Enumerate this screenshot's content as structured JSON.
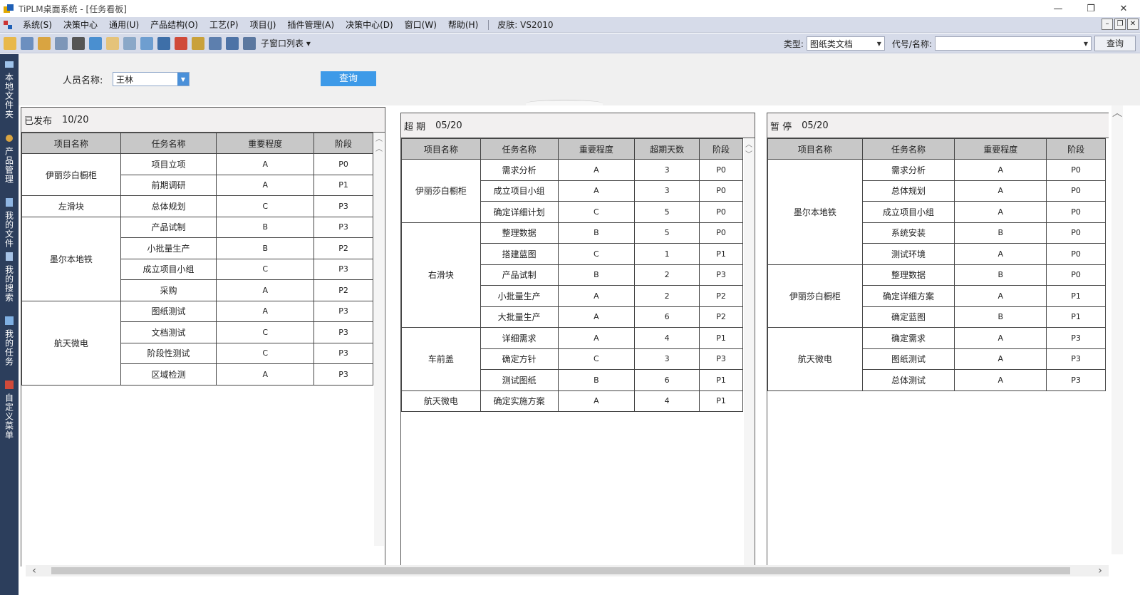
{
  "window": {
    "title": "TiPLM桌面系统 - [任务看板]",
    "minimize": "—",
    "restore": "❐",
    "close": "✕"
  },
  "menubar": {
    "items": [
      "系统(S)",
      "决策中心",
      "通用(U)",
      "产品结构(O)",
      "工艺(P)",
      "项目(J)",
      "插件管理(A)",
      "决策中心(D)",
      "窗口(W)",
      "帮助(H)"
    ],
    "skin": "皮肤:  VS2010",
    "mdi": [
      "–",
      "❐",
      "✕"
    ]
  },
  "toolbar": {
    "subwindow_list": "子窗口列表 ▾",
    "type_label": "类型:",
    "type_value": "图纸类文档",
    "code_label": "代号/名称:",
    "code_value": "",
    "query": "查询"
  },
  "sidebar": {
    "items": [
      "本地文件夹",
      "产品管理",
      "我的文件",
      "我的搜索",
      "我的任务",
      "自定义菜单"
    ]
  },
  "filter": {
    "person_label": "人员名称:",
    "person_value": "王林",
    "search": "查询"
  },
  "colors": {
    "sidebar_bg": "#2c3e5c",
    "menubar_bg": "#d6dbe9",
    "accent": "#3d9ae8",
    "header_bg": "#c8c8c8"
  },
  "panels": {
    "published": {
      "title": "已发布",
      "count": "10/20",
      "headers": [
        "项目名称",
        "任务名称",
        "重要程度",
        "阶段"
      ],
      "groups": [
        {
          "project": "伊丽莎白橱柜",
          "rows": [
            [
              "项目立项",
              "A",
              "P0"
            ],
            [
              "前期调研",
              "A",
              "P1"
            ]
          ]
        },
        {
          "project": "左滑块",
          "rows": [
            [
              "总体规划",
              "C",
              "P3"
            ]
          ]
        },
        {
          "project": "墨尔本地铁",
          "rows": [
            [
              "产品试制",
              "B",
              "P3"
            ],
            [
              "小批量生产",
              "B",
              "P2"
            ],
            [
              "成立项目小组",
              "C",
              "P3"
            ],
            [
              "采购",
              "A",
              "P2"
            ]
          ]
        },
        {
          "project": "航天微电",
          "rows": [
            [
              "图纸测试",
              "A",
              "P3"
            ],
            [
              "文档测试",
              "C",
              "P3"
            ],
            [
              "阶段性测试",
              "C",
              "P3"
            ],
            [
              "区域检测",
              "A",
              "P3"
            ]
          ]
        }
      ]
    },
    "overdue": {
      "title": "超  期",
      "count": "05/20",
      "headers": [
        "项目名称",
        "任务名称",
        "重要程度",
        "超期天数",
        "阶段"
      ],
      "groups": [
        {
          "project": "伊丽莎白橱柜",
          "rows": [
            [
              "需求分析",
              "A",
              "3",
              "P0"
            ],
            [
              "成立项目小组",
              "A",
              "3",
              "P0"
            ],
            [
              "确定详细计划",
              "C",
              "5",
              "P0"
            ]
          ]
        },
        {
          "project": "右滑块",
          "rows": [
            [
              "整理数据",
              "B",
              "5",
              "P0"
            ],
            [
              "搭建蓝图",
              "C",
              "1",
              "P1"
            ],
            [
              "产品试制",
              "B",
              "2",
              "P3"
            ],
            [
              "小批量生产",
              "A",
              "2",
              "P2"
            ],
            [
              "大批量生产",
              "A",
              "6",
              "P2"
            ]
          ]
        },
        {
          "project": "车前盖",
          "rows": [
            [
              "详细需求",
              "A",
              "4",
              "P1"
            ],
            [
              "确定方针",
              "C",
              "3",
              "P3"
            ],
            [
              "测试图纸",
              "B",
              "6",
              "P1"
            ]
          ]
        },
        {
          "project": "航天微电",
          "rows": [
            [
              "确定实施方案",
              "A",
              "4",
              "P1"
            ]
          ]
        }
      ]
    },
    "paused": {
      "title": "暂  停",
      "count": "05/20",
      "headers": [
        "项目名称",
        "任务名称",
        "重要程度",
        "阶段"
      ],
      "groups": [
        {
          "project": "墨尔本地铁",
          "rows": [
            [
              "需求分析",
              "A",
              "P0"
            ],
            [
              "总体规划",
              "A",
              "P0"
            ],
            [
              "成立项目小组",
              "A",
              "P0"
            ],
            [
              "系统安装",
              "B",
              "P0"
            ],
            [
              "测试环境",
              "A",
              "P0"
            ]
          ]
        },
        {
          "project": "伊丽莎白橱柜",
          "rows": [
            [
              "整理数据",
              "B",
              "P0"
            ],
            [
              "确定详细方案",
              "A",
              "P1"
            ],
            [
              "确定蓝图",
              "B",
              "P1"
            ]
          ]
        },
        {
          "project": "航天微电",
          "rows": [
            [
              "确定需求",
              "A",
              "P3"
            ],
            [
              "图纸测试",
              "A",
              "P3"
            ],
            [
              "总体测试",
              "A",
              "P3"
            ]
          ]
        }
      ]
    }
  }
}
